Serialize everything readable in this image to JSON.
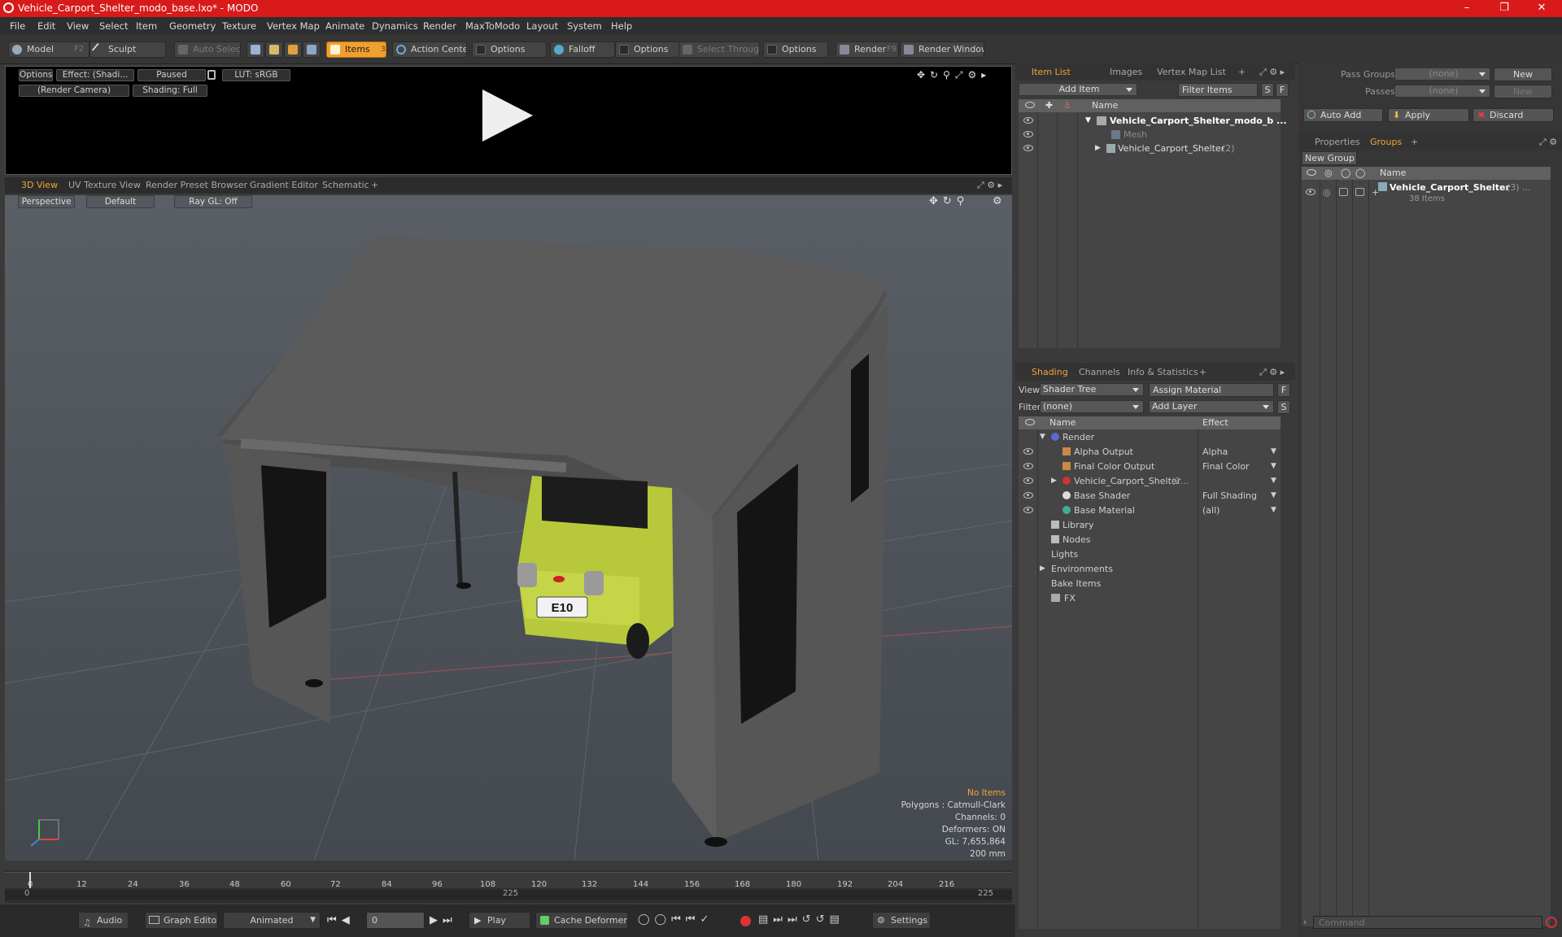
{
  "window": {
    "title": "Vehicle_Carport_Shelter_modo_base.lxo* - MODO"
  },
  "menu": [
    "File",
    "Edit",
    "View",
    "Select",
    "Item",
    "Geometry",
    "Texture",
    "Vertex Map",
    "Animate",
    "Dynamics",
    "Render",
    "MaxToModo",
    "Layout",
    "System",
    "Help"
  ],
  "toolbar": {
    "model": "Model",
    "model_key": "F2",
    "sculpt": "Sculpt",
    "auto_select": "Auto Select",
    "items": "Items",
    "items_key": "3",
    "action_center": "Action Center",
    "options1": "Options",
    "falloff": "Falloff",
    "options2": "Options",
    "select_through": "Select Through",
    "options3": "Options",
    "render": "Render",
    "render_key": "F9",
    "render_window": "Render Window"
  },
  "render_preview": {
    "options": "Options",
    "effect": "Effect: (Shadi...",
    "paused": "Paused",
    "lut": "LUT: sRGB",
    "camera": "(Render Camera)",
    "shading": "Shading: Full"
  },
  "view_tabs": [
    "3D View",
    "UV Texture View",
    "Render Preset Browser",
    "Gradient Editor",
    "Schematic",
    "+"
  ],
  "viewport": {
    "perspective": "Perspective",
    "default": "Default",
    "raygl": "Ray GL: Off",
    "plate": "E10",
    "stats": {
      "no_items": "No Items",
      "polygons": "Polygons : Catmull-Clark",
      "channels": "Channels: 0",
      "deformers": "Deformers: ON",
      "gl": "GL: 7,655,864",
      "size": "200 mm"
    }
  },
  "timeline": {
    "ticks": [
      "0",
      "12",
      "24",
      "36",
      "48",
      "60",
      "72",
      "84",
      "96",
      "108",
      "120",
      "132",
      "144",
      "156",
      "168",
      "180",
      "192",
      "204",
      "216"
    ],
    "start": "0",
    "mid": "225",
    "end": "225"
  },
  "bottom": {
    "audio": "Audio",
    "graph_editor": "Graph Editor",
    "animated": "Animated",
    "frame": "0",
    "play": "Play",
    "cache_deformers": "Cache Deformers",
    "settings": "Settings"
  },
  "item_list": {
    "tabs": [
      "Item List",
      "Images",
      "Vertex Map List",
      "+"
    ],
    "add_item": "Add Item",
    "filter_items": "Filter Items",
    "s": "S",
    "f": "F",
    "col_name": "Name",
    "rows": [
      {
        "label": "Vehicle_Carport_Shelter_modo_b ..."
      },
      {
        "label": "Mesh"
      },
      {
        "label": "Vehicle_Carport_Shelter",
        "count": "(2)"
      }
    ]
  },
  "shading": {
    "tabs": [
      "Shading",
      "Channels",
      "Info & Statistics",
      "+"
    ],
    "view_label": "View",
    "view_value": "Shader Tree",
    "assign_material": "Assign Material",
    "f": "F",
    "filter_label": "Filter",
    "filter_value": "(none)",
    "add_layer": "Add Layer",
    "s": "S",
    "col_name": "Name",
    "col_effect": "Effect",
    "rows": [
      {
        "label": "Render",
        "effect": ""
      },
      {
        "label": "Alpha Output",
        "effect": "Alpha"
      },
      {
        "label": "Final Color Output",
        "effect": "Final Color"
      },
      {
        "label": "Vehicle_Carport_Shelter",
        "suffix": "(2...",
        "effect": ""
      },
      {
        "label": "Base Shader",
        "effect": "Full Shading"
      },
      {
        "label": "Base Material",
        "effect": "(all)"
      },
      {
        "label": "Library",
        "effect": ""
      },
      {
        "label": "Nodes",
        "effect": ""
      },
      {
        "label": "Lights",
        "effect": ""
      },
      {
        "label": "Environments",
        "effect": ""
      },
      {
        "label": "Bake Items",
        "effect": ""
      },
      {
        "label": "FX",
        "effect": ""
      }
    ]
  },
  "groups_panel": {
    "pass_groups_label": "Pass Groups",
    "pass_groups_value": "(none)",
    "new": "New",
    "passes_label": "Passes",
    "passes_value": "(none)",
    "new2": "New",
    "auto_add": "Auto Add",
    "apply": "Apply",
    "discard": "Discard",
    "tabs": [
      "Properties",
      "Groups",
      "+"
    ],
    "new_group": "New Group",
    "col_name": "Name",
    "group_name": "Vehicle_Carport_Shelter",
    "group_count": "(3) ...",
    "group_items": "38 Items"
  },
  "command": {
    "placeholder": "Command"
  },
  "colors": {
    "accent": "#f2a33a",
    "titlebar": "#d81a1a",
    "car": "#b7c93a"
  }
}
